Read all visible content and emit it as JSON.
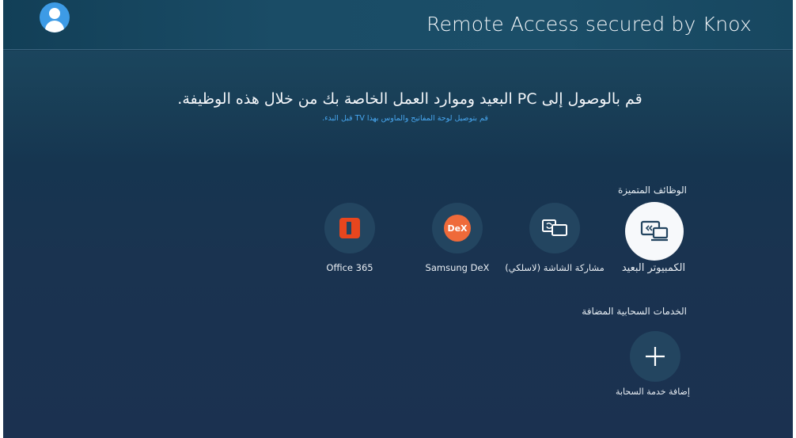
{
  "header": {
    "title": "Remote Access secured by Knox"
  },
  "hero": {
    "main_text": "قم بالوصول إلى PC البعيد وموارد العمل الخاصة بك من خلال هذه الوظيفة.",
    "sub_text": "قم بتوصيل لوحة المفاتيح والماوس بهذا TV قبل البدء."
  },
  "featured": {
    "heading": "الوظائف المتميزة",
    "items": [
      {
        "label": "الكمبيوتر البعيد",
        "icon": "remote-pc-icon",
        "focused": true
      },
      {
        "label": "مشاركة الشاشة (لاسلكي)",
        "icon": "screen-share-icon",
        "focused": false
      },
      {
        "label": "Samsung DeX",
        "icon": "dex-icon",
        "logo_text": "DeX",
        "focused": false
      },
      {
        "label": "Office 365",
        "icon": "office-icon",
        "focused": false
      }
    ]
  },
  "cloud": {
    "heading": "الخدمات السحابية المضافة",
    "add_label": "إضافة خدمة السحابة",
    "add_icon": "plus-icon"
  },
  "colors": {
    "accent_blue": "#47a6ef",
    "avatar": "#3d9be6",
    "office": "#e8461e",
    "dex": "#ef6a3a"
  }
}
